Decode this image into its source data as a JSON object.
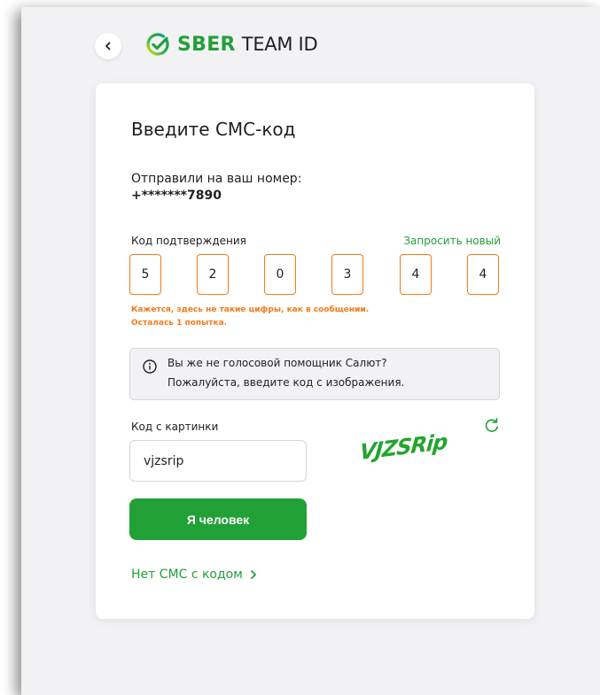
{
  "logo": {
    "brand": "SBER",
    "product": "TEAM ID"
  },
  "heading": "Введите СМС-код",
  "sent_to": {
    "label": "Отправили на ваш номер:",
    "phone": "+*******7890"
  },
  "code": {
    "label": "Код подтверждения",
    "request_new": "Запросить новый",
    "digits": [
      "5",
      "2",
      "0",
      "3",
      "4",
      "4"
    ],
    "error_line1": "Кажется, здесь не такие цифры, как в сообщении.",
    "error_line2": "Осталась 1 попытка."
  },
  "info": {
    "line1": "Вы же не голосовой помощник Салют?",
    "line2": "Пожалуйста, введите код с изображения."
  },
  "captcha": {
    "label": "Код с картинки",
    "value": "vjzsrip",
    "image_text": "VJZSRip"
  },
  "human_button": "Я человек",
  "no_sms_link": "Нет СМС с кодом",
  "icons": {
    "back": "chevron-left-icon",
    "logo": "sber-check-icon",
    "info": "info-icon",
    "refresh": "refresh-icon",
    "link_chevron": "chevron-right-icon"
  },
  "colors": {
    "brand_green": "#21a038",
    "error_orange": "#f27b19",
    "background": "#f2f2f4",
    "text": "#1f1f22"
  }
}
